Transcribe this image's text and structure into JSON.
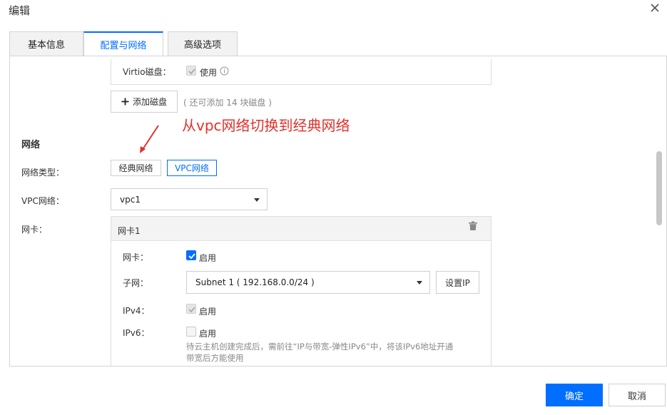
{
  "dialog": {
    "title": "编辑"
  },
  "tabs": [
    {
      "label": "基本信息"
    },
    {
      "label": "配置与网络"
    },
    {
      "label": "高级选项"
    }
  ],
  "disk": {
    "virtio_label": "Virtio磁盘：",
    "virtio_option": "使用",
    "add_button": "添加磁盘",
    "add_hint": "( 还可添加 14 块磁盘 )"
  },
  "annotation": {
    "text": "从vpc网络切换到经典网络"
  },
  "network": {
    "section_title": "网络",
    "type_label": "网络类型：",
    "type_options": [
      "经典网络",
      "VPC网络"
    ],
    "vpc_label": "VPC网络：",
    "vpc_value": "vpc1",
    "nic_label": "网卡："
  },
  "nic": {
    "title": "网卡1",
    "nic_label": "网卡：",
    "nic_enable": "启用",
    "subnet_label": "子网：",
    "subnet_value": "Subnet 1 ( 192.168.0.0/24 )",
    "set_ip_button": "设置IP",
    "ipv4_label": "IPv4：",
    "ipv4_enable": "启用",
    "ipv6_label": "IPv6：",
    "ipv6_enable": "启用",
    "ipv6_hint_line1": "待云主机创建完成后，需前往“IP与带宽-弹性IPv6”中，将该IPv6地址开通",
    "ipv6_hint_line2": "带宽后方能使用"
  },
  "footer": {
    "confirm": "确定",
    "cancel": "取消"
  },
  "colors": {
    "accent": "#006eff",
    "annotation": "#e0312b"
  }
}
